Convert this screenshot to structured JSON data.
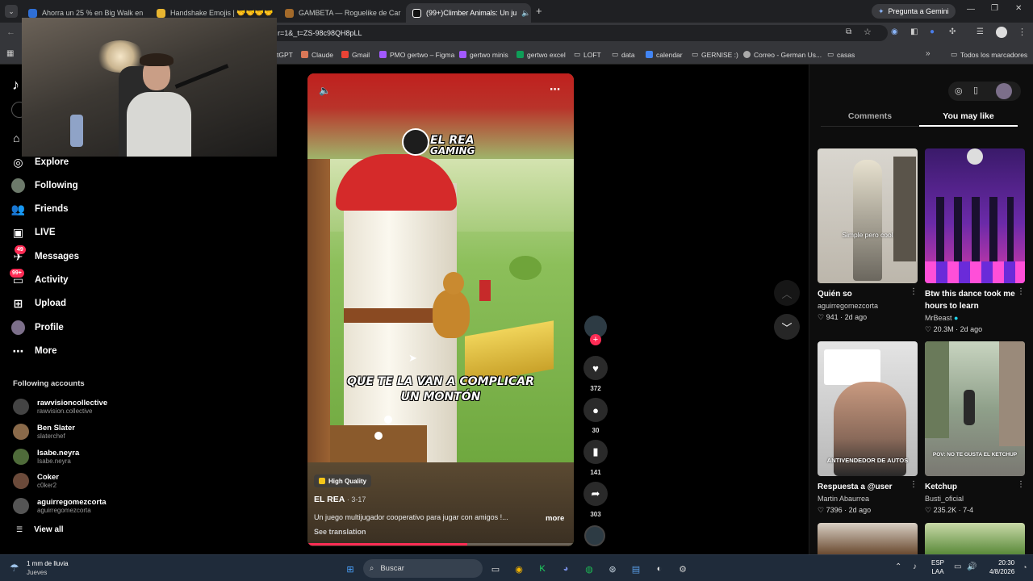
{
  "browser": {
    "tabs": [
      {
        "title": "Ahorra un 25 % en Big Walk en"
      },
      {
        "title": "Handshake Emojis | 🤝🤝🤝🤝"
      },
      {
        "title": "GAMBETA — Roguelike de Car"
      },
      {
        "title": "(99+)Climber Animals: Un ju"
      }
    ],
    "gemini_button": "Pregunta a Gemini",
    "url": "r=1&_t=ZS-98c98QH8pLL",
    "bookmarks": [
      "tGPT",
      "Claude",
      "Gmail",
      "PMO gertwo – Figma",
      "gertwo minis",
      "gertwo excel",
      "LOFT",
      "data",
      "calendar",
      "GERNISE :)",
      "Correo - German Us...",
      "casas"
    ],
    "all_bookmarks": "Todos los marcadores"
  },
  "sidebar": {
    "nav": [
      {
        "label": "Explore",
        "icon": "compass-icon"
      },
      {
        "label": "Following",
        "icon": "following-avatar-icon"
      },
      {
        "label": "Friends",
        "icon": "friends-icon"
      },
      {
        "label": "LIVE",
        "icon": "live-icon"
      },
      {
        "label": "Messages",
        "icon": "messages-icon",
        "badge": "49"
      },
      {
        "label": "Activity",
        "icon": "activity-icon",
        "badge": "99+"
      },
      {
        "label": "Upload",
        "icon": "upload-icon"
      },
      {
        "label": "Profile",
        "icon": "profile-avatar-icon"
      },
      {
        "label": "More",
        "icon": "more-icon"
      }
    ],
    "following_title": "Following accounts",
    "accounts": [
      {
        "name": "rawvisioncollective",
        "handle": "rawvision.collective",
        "color": "#444"
      },
      {
        "name": "Ben Slater",
        "handle": "slaterchef",
        "color": "#8a6a4a"
      },
      {
        "name": "Isabe.neyra",
        "handle": "Isabe.neyra",
        "color": "#4f6b3a"
      },
      {
        "name": "Coker",
        "handle": "c0ker2",
        "color": "#6b4a3a"
      },
      {
        "name": "aguirregomezcorta",
        "handle": "aguirregomezcorta",
        "color": "#555"
      }
    ],
    "view_all": "View all"
  },
  "video": {
    "channel_logo_line1": "EL REA",
    "channel_logo_line2": "GAMING",
    "caption_line1": "QUE TE LA VAN A COMPLICAR",
    "caption_line2": "UN MONTÓN",
    "quality_badge": "High Quality",
    "author": "EL REA",
    "date": "· 3-17",
    "description": "Un juego multijugador cooperativo para jugar con amigos !...",
    "more": "more",
    "see_translation": "See translation",
    "progress": 0.6
  },
  "actions": {
    "likes": "372",
    "comments": "30",
    "saves": "141",
    "shares": "303"
  },
  "panel": {
    "tab_comments": "Comments",
    "tab_you_may_like": "You may like",
    "cards": [
      {
        "overlay": "Simple pero cool",
        "title": "Quién so",
        "author": "aguirregomezcorta",
        "likes": "941",
        "date": "2d ago",
        "verified": false
      },
      {
        "overlay": "",
        "title": "Btw this dance took me hours to learn",
        "author": "MrBeast",
        "likes": "20.3M",
        "date": "2d ago",
        "verified": true
      },
      {
        "overlay": "ANTIVENDEDOR DE AUTOS",
        "title": "Respuesta a @user",
        "author": "Martin Abaurrea",
        "likes": "7396",
        "date": "2d ago",
        "verified": false
      },
      {
        "overlay": "POV: NO TE GUSTA EL KETCHUP",
        "title": "Ketchup",
        "author": "Busti_oficial",
        "likes": "235.2K",
        "date": "7-4",
        "verified": false
      }
    ]
  },
  "taskbar": {
    "weather_line1": "1 mm de lluvia",
    "weather_line2": "Jueves",
    "search": "Buscar",
    "lang1": "ESP",
    "lang2": "LAA",
    "time": "20:30",
    "date": "4/8/2026"
  }
}
